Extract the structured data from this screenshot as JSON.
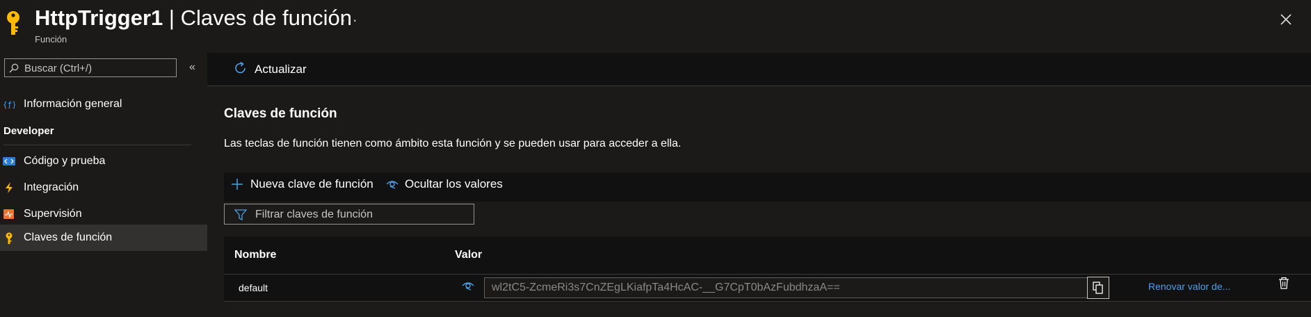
{
  "header": {
    "title_bold": "HttpTrigger1",
    "title_rest": "| Claves de función",
    "subtitle": "Función",
    "more_label": "···",
    "icon": "key-icon",
    "close_icon": "close-icon"
  },
  "sidebar": {
    "search_placeholder": "Buscar (Ctrl+/)",
    "collapse_label": "«",
    "overview_label": "Información general",
    "section_title": "Developer",
    "items": [
      {
        "label": "Código y prueba",
        "icon": "code-icon"
      },
      {
        "label": "Integración",
        "icon": "lightning-icon"
      },
      {
        "label": "Supervisión",
        "icon": "monitor-icon"
      },
      {
        "label": "Claves de función",
        "icon": "key-icon",
        "selected": true
      }
    ]
  },
  "toolbar": {
    "refresh_label": "Actualizar",
    "refresh_icon": "refresh-icon"
  },
  "main": {
    "title": "Claves de función",
    "description": "Las teclas de función tienen como ámbito esta función y se pueden usar para acceder a ella.",
    "new_key_label": "Nueva clave de función",
    "hide_values_label": "Ocultar los valores",
    "filter_placeholder": "Filtrar claves de función",
    "table": {
      "columns": [
        "Nombre",
        "Valor"
      ],
      "rows": [
        {
          "name": "default",
          "value": "wl2tC5-ZcmeRi3s7CnZEgLKiafpTa4HcAC-__G7CpT0bAzFubdhzaA==",
          "renew_label": "Renovar valor de..."
        }
      ]
    }
  },
  "colors": {
    "background": "#1b1a19",
    "panel": "#111111",
    "accent": "#4f9fe8",
    "key_yellow": "#ffb900"
  }
}
